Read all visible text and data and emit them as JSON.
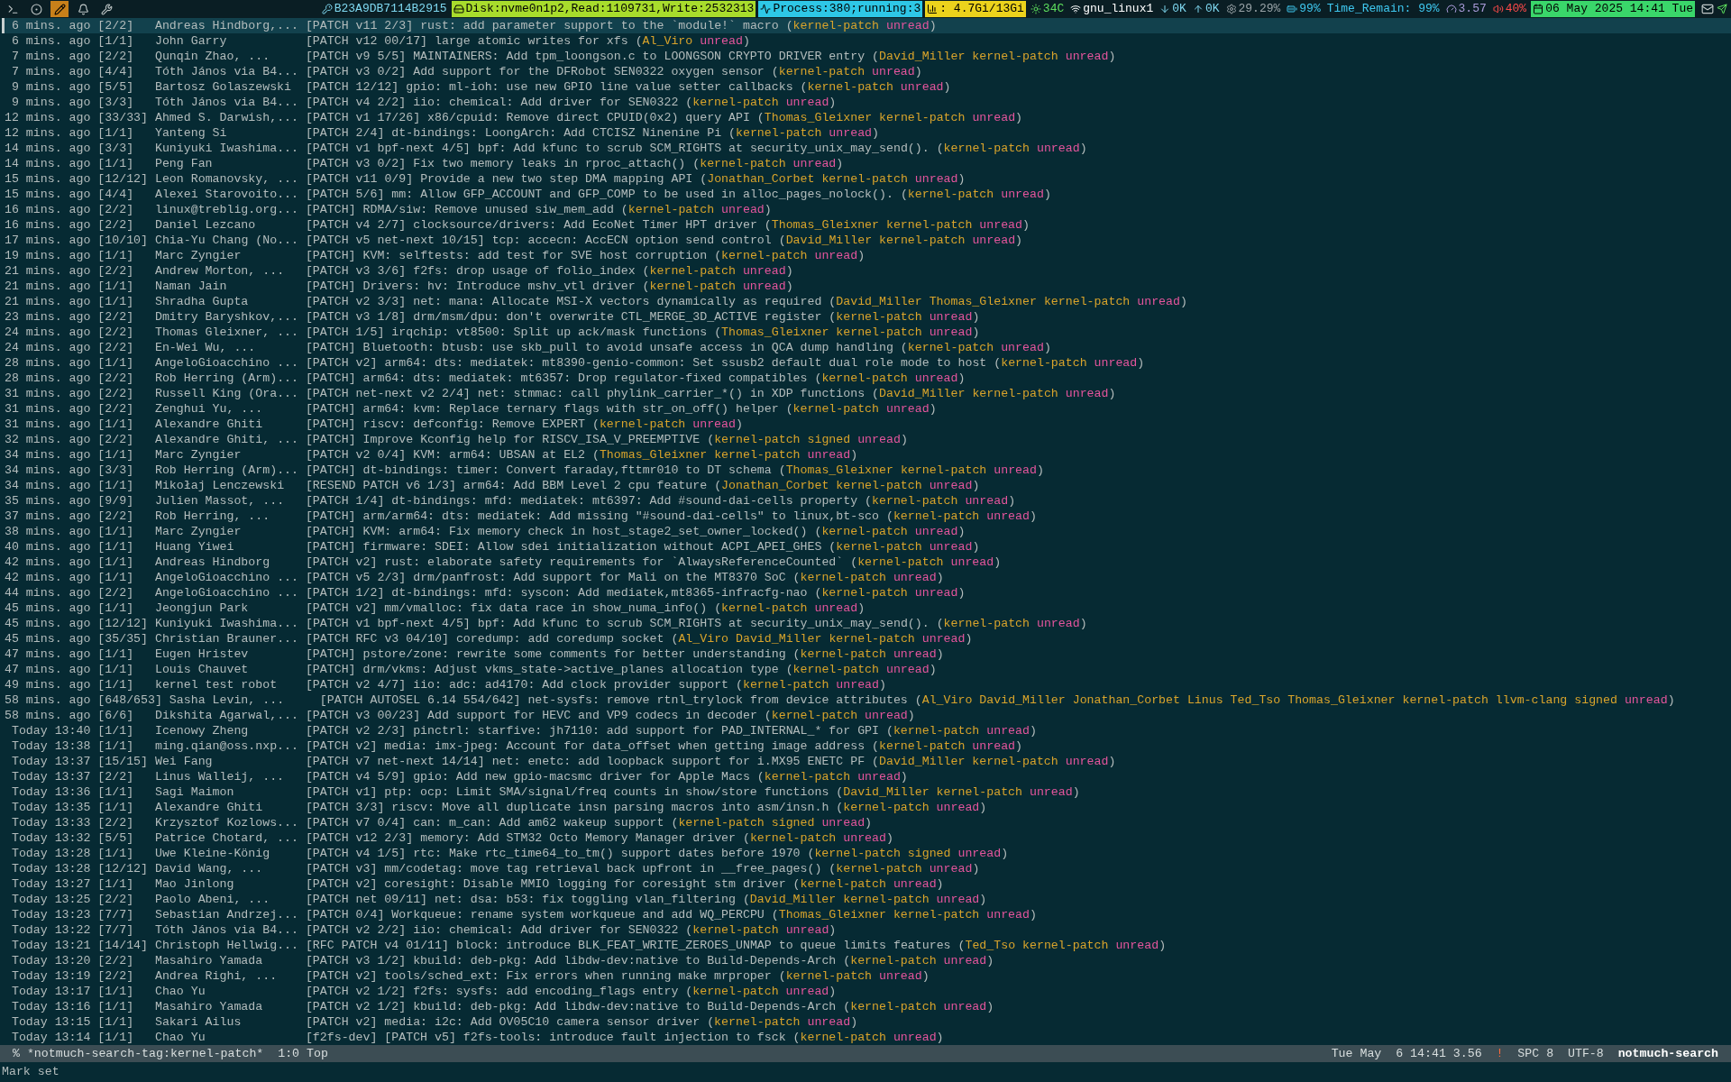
{
  "launcher": [
    {
      "selected": false
    },
    {
      "selected": false
    },
    {
      "selected": true
    },
    {
      "selected": false
    },
    {
      "selected": false
    }
  ],
  "status_items": [
    {
      "kind": "key",
      "text": "B23A9DB7114B2915"
    },
    {
      "kind": "disk",
      "text": "Disk:nvme0n1p2,Read:1109731,Write:2532313"
    },
    {
      "kind": "process",
      "text": "Process:380;running:3"
    },
    {
      "kind": "memory",
      "text": ": 4.7Gi/13Gi"
    },
    {
      "kind": "temp",
      "text": "34C"
    },
    {
      "kind": "wifi",
      "text": "gnu_linux1"
    },
    {
      "kind": "down",
      "text": "0K"
    },
    {
      "kind": "up",
      "text": "0K"
    },
    {
      "kind": "cpu",
      "text": "29.29%"
    },
    {
      "kind": "battery",
      "text": "99%"
    },
    {
      "kind": "plain",
      "text": "Time_Remain: 99%"
    },
    {
      "kind": "load",
      "text": "3.57"
    },
    {
      "kind": "volume",
      "text": "40%"
    },
    {
      "kind": "clock",
      "text": "06 May 2025 14:41 Tue"
    }
  ],
  "tag_brackets": [
    "(",
    ")"
  ],
  "rows": [
    {
      "date": "6 mins. ago",
      "count": "[2/2]",
      "authors": "Andreas Hindborg,...",
      "subject": "[PATCH v11 2/3] rust: add parameter support to the `module!` macro",
      "selected": true,
      "tags": [
        {
          "name": "kernel-patch",
          "color": "#d9a42b"
        },
        {
          "name": "unread",
          "color": "#e5559d"
        }
      ]
    },
    {
      "date": "6 mins. ago",
      "count": "[1/1]",
      "authors": "John Garry",
      "subject": "[PATCH v12 00/17] large atomic writes for xfs",
      "selected": false,
      "tags": [
        {
          "name": "Al_Viro",
          "color": "#d9a42b"
        },
        {
          "name": "unread",
          "color": "#e5559d"
        }
      ]
    },
    {
      "date": "7 mins. ago",
      "count": "[2/2]",
      "authors": "Qunqin Zhao, ...",
      "subject": "[PATCH v9 5/5] MAINTAINERS: Add tpm_loongson.c to LOONGSON CRYPTO DRIVER entry",
      "selected": false,
      "tags": [
        {
          "name": "David_Miller",
          "color": "#d9a42b"
        },
        {
          "name": "kernel-patch",
          "color": "#d9a42b"
        },
        {
          "name": "unread",
          "color": "#e5559d"
        }
      ]
    },
    {
      "date": "7 mins. ago",
      "count": "[4/4]",
      "authors": "Tóth János via B4...",
      "subject": "[PATCH v3 0/2] Add support for the DFRobot SEN0322 oxygen sensor",
      "selected": false,
      "tags": [
        {
          "name": "kernel-patch",
          "color": "#d9a42b"
        },
        {
          "name": "unread",
          "color": "#e5559d"
        }
      ]
    },
    {
      "date": "9 mins. ago",
      "count": "[5/5]",
      "authors": "Bartosz Golaszewski",
      "subject": "[PATCH 12/12] gpio: ml-ioh: use new GPIO line value setter callbacks",
      "selected": false,
      "tags": [
        {
          "name": "kernel-patch",
          "color": "#d9a42b"
        },
        {
          "name": "unread",
          "color": "#e5559d"
        }
      ]
    },
    {
      "date": "9 mins. ago",
      "count": "[3/3]",
      "authors": "Tóth János via B4...",
      "subject": "[PATCH v4 2/2] iio: chemical: Add driver for SEN0322",
      "selected": false,
      "tags": [
        {
          "name": "kernel-patch",
          "color": "#d9a42b"
        },
        {
          "name": "unread",
          "color": "#e5559d"
        }
      ]
    },
    {
      "date": "12 mins. ago",
      "count": "[33/33]",
      "authors": "Ahmed S. Darwish,...",
      "subject": "[PATCH v1 17/26] x86/cpuid: Remove direct CPUID(0x2) query API",
      "selected": false,
      "tags": [
        {
          "name": "Thomas_Gleixner",
          "color": "#d9a42b"
        },
        {
          "name": "kernel-patch",
          "color": "#d9a42b"
        },
        {
          "name": "unread",
          "color": "#e5559d"
        }
      ]
    },
    {
      "date": "12 mins. ago",
      "count": "[1/1]",
      "authors": "Yanteng Si",
      "subject": "[PATCH 2/4] dt-bindings: LoongArch: Add CTCISZ Ninenine Pi",
      "selected": false,
      "tags": [
        {
          "name": "kernel-patch",
          "color": "#d9a42b"
        },
        {
          "name": "unread",
          "color": "#e5559d"
        }
      ]
    },
    {
      "date": "14 mins. ago",
      "count": "[3/3]",
      "authors": "Kuniyuki Iwashima...",
      "subject": "[PATCH v1 bpf-next 4/5] bpf: Add kfunc to scrub SCM_RIGHTS at security_unix_may_send().",
      "selected": false,
      "tags": [
        {
          "name": "kernel-patch",
          "color": "#d9a42b"
        },
        {
          "name": "unread",
          "color": "#e5559d"
        }
      ]
    },
    {
      "date": "14 mins. ago",
      "count": "[1/1]",
      "authors": "Peng Fan",
      "subject": "[PATCH v3 0/2] Fix two memory leaks in rproc_attach()",
      "selected": false,
      "tags": [
        {
          "name": "kernel-patch",
          "color": "#d9a42b"
        },
        {
          "name": "unread",
          "color": "#e5559d"
        }
      ]
    },
    {
      "date": "15 mins. ago",
      "count": "[12/12]",
      "authors": "Leon Romanovsky, ...",
      "subject": "[PATCH v11 0/9] Provide a new two step DMA mapping API",
      "selected": false,
      "tags": [
        {
          "name": "Jonathan_Corbet",
          "color": "#d9a42b"
        },
        {
          "name": "kernel-patch",
          "color": "#d9a42b"
        },
        {
          "name": "unread",
          "color": "#e5559d"
        }
      ]
    },
    {
      "date": "15 mins. ago",
      "count": "[4/4]",
      "authors": "Alexei Starovoito...",
      "subject": "[PATCH 5/6] mm: Allow GFP_ACCOUNT and GFP_COMP to be used in alloc_pages_nolock().",
      "selected": false,
      "tags": [
        {
          "name": "kernel-patch",
          "color": "#d9a42b"
        },
        {
          "name": "unread",
          "color": "#e5559d"
        }
      ]
    },
    {
      "date": "16 mins. ago",
      "count": "[2/2]",
      "authors": "linux@treblig.org...",
      "subject": "[PATCH] RDMA/siw: Remove unused siw_mem_add",
      "selected": false,
      "tags": [
        {
          "name": "kernel-patch",
          "color": "#d9a42b"
        },
        {
          "name": "unread",
          "color": "#e5559d"
        }
      ]
    },
    {
      "date": "16 mins. ago",
      "count": "[2/2]",
      "authors": "Daniel Lezcano",
      "subject": "[PATCH v4 2/7] clocksource/drivers: Add EcoNet Timer HPT driver",
      "selected": false,
      "tags": [
        {
          "name": "Thomas_Gleixner",
          "color": "#d9a42b"
        },
        {
          "name": "kernel-patch",
          "color": "#d9a42b"
        },
        {
          "name": "unread",
          "color": "#e5559d"
        }
      ]
    },
    {
      "date": "17 mins. ago",
      "count": "[10/10]",
      "authors": "Chia-Yu Chang (No...",
      "subject": "[PATCH v5 net-next 10/15] tcp: accecn: AccECN option send control",
      "selected": false,
      "tags": [
        {
          "name": "David_Miller",
          "color": "#d9a42b"
        },
        {
          "name": "kernel-patch",
          "color": "#d9a42b"
        },
        {
          "name": "unread",
          "color": "#e5559d"
        }
      ]
    },
    {
      "date": "19 mins. ago",
      "count": "[1/1]",
      "authors": "Marc Zyngier",
      "subject": "[PATCH] KVM: selftests: add test for SVE host corruption",
      "selected": false,
      "tags": [
        {
          "name": "kernel-patch",
          "color": "#d9a42b"
        },
        {
          "name": "unread",
          "color": "#e5559d"
        }
      ]
    },
    {
      "date": "21 mins. ago",
      "count": "[2/2]",
      "authors": "Andrew Morton, ...",
      "subject": "[PATCH v3 3/6] f2fs: drop usage of folio_index",
      "selected": false,
      "tags": [
        {
          "name": "kernel-patch",
          "color": "#d9a42b"
        },
        {
          "name": "unread",
          "color": "#e5559d"
        }
      ]
    },
    {
      "date": "21 mins. ago",
      "count": "[1/1]",
      "authors": "Naman Jain",
      "subject": "[PATCH] Drivers: hv: Introduce mshv_vtl driver",
      "selected": false,
      "tags": [
        {
          "name": "kernel-patch",
          "color": "#d9a42b"
        },
        {
          "name": "unread",
          "color": "#e5559d"
        }
      ]
    },
    {
      "date": "21 mins. ago",
      "count": "[1/1]",
      "authors": "Shradha Gupta",
      "subject": "[PATCH v2 3/3] net: mana: Allocate MSI-X vectors dynamically as required",
      "selected": false,
      "tags": [
        {
          "name": "David_Miller",
          "color": "#d9a42b"
        },
        {
          "name": "Thomas_Gleixner",
          "color": "#d9a42b"
        },
        {
          "name": "kernel-patch",
          "color": "#d9a42b"
        },
        {
          "name": "unread",
          "color": "#e5559d"
        }
      ]
    },
    {
      "date": "23 mins. ago",
      "count": "[2/2]",
      "authors": "Dmitry Baryshkov,...",
      "subject": "[PATCH v3 1/8] drm/msm/dpu: don't overwrite CTL_MERGE_3D_ACTIVE register",
      "selected": false,
      "tags": [
        {
          "name": "kernel-patch",
          "color": "#d9a42b"
        },
        {
          "name": "unread",
          "color": "#e5559d"
        }
      ]
    },
    {
      "date": "24 mins. ago",
      "count": "[2/2]",
      "authors": "Thomas Gleixner, ...",
      "subject": "[PATCH 1/5] irqchip: vt8500: Split up ack/mask functions",
      "selected": false,
      "tags": [
        {
          "name": "Thomas_Gleixner",
          "color": "#d9a42b"
        },
        {
          "name": "kernel-patch",
          "color": "#d9a42b"
        },
        {
          "name": "unread",
          "color": "#e5559d"
        }
      ]
    },
    {
      "date": "24 mins. ago",
      "count": "[2/2]",
      "authors": "En-Wei Wu, ...",
      "subject": "[PATCH] Bluetooth: btusb: use skb_pull to avoid unsafe access in QCA dump handling",
      "selected": false,
      "tags": [
        {
          "name": "kernel-patch",
          "color": "#d9a42b"
        },
        {
          "name": "unread",
          "color": "#e5559d"
        }
      ]
    },
    {
      "date": "28 mins. ago",
      "count": "[1/1]",
      "authors": "AngeloGioacchino ...",
      "subject": "[PATCH v2] arm64: dts: mediatek: mt8390-genio-common: Set ssusb2 default dual role mode to host",
      "selected": false,
      "tags": [
        {
          "name": "kernel-patch",
          "color": "#d9a42b"
        },
        {
          "name": "unread",
          "color": "#e5559d"
        }
      ]
    },
    {
      "date": "28 mins. ago",
      "count": "[2/2]",
      "authors": "Rob Herring (Arm)...",
      "subject": "[PATCH] arm64: dts: mediatek: mt6357: Drop regulator-fixed compatibles",
      "selected": false,
      "tags": [
        {
          "name": "kernel-patch",
          "color": "#d9a42b"
        },
        {
          "name": "unread",
          "color": "#e5559d"
        }
      ]
    },
    {
      "date": "31 mins. ago",
      "count": "[2/2]",
      "authors": "Russell King (Ora...",
      "subject": "[PATCH net-next v2 2/4] net: stmmac: call phylink_carrier_*() in XDP functions",
      "selected": false,
      "tags": [
        {
          "name": "David_Miller",
          "color": "#d9a42b"
        },
        {
          "name": "kernel-patch",
          "color": "#d9a42b"
        },
        {
          "name": "unread",
          "color": "#e5559d"
        }
      ]
    },
    {
      "date": "31 mins. ago",
      "count": "[2/2]",
      "authors": "Zenghui Yu, ...",
      "subject": "[PATCH] arm64: kvm: Replace ternary flags with str_on_off() helper",
      "selected": false,
      "tags": [
        {
          "name": "kernel-patch",
          "color": "#d9a42b"
        },
        {
          "name": "unread",
          "color": "#e5559d"
        }
      ]
    },
    {
      "date": "31 mins. ago",
      "count": "[1/1]",
      "authors": "Alexandre Ghiti",
      "subject": "[PATCH] riscv: defconfig: Remove EXPERT",
      "selected": false,
      "tags": [
        {
          "name": "kernel-patch",
          "color": "#d9a42b"
        },
        {
          "name": "unread",
          "color": "#e5559d"
        }
      ]
    },
    {
      "date": "32 mins. ago",
      "count": "[2/2]",
      "authors": "Alexandre Ghiti, ...",
      "subject": "[PATCH] Improve Kconfig help for RISCV_ISA_V_PREEMPTIVE",
      "selected": false,
      "tags": [
        {
          "name": "kernel-patch",
          "color": "#d9a42b"
        },
        {
          "name": "signed",
          "color": "#d9a42b"
        },
        {
          "name": "unread",
          "color": "#e5559d"
        }
      ]
    },
    {
      "date": "34 mins. ago",
      "count": "[1/1]",
      "authors": "Marc Zyngier",
      "subject": "[PATCH v2 0/4] KVM: arm64: UBSAN at EL2",
      "selected": false,
      "tags": [
        {
          "name": "Thomas_Gleixner",
          "color": "#d9a42b"
        },
        {
          "name": "kernel-patch",
          "color": "#d9a42b"
        },
        {
          "name": "unread",
          "color": "#e5559d"
        }
      ]
    },
    {
      "date": "34 mins. ago",
      "count": "[3/3]",
      "authors": "Rob Herring (Arm)...",
      "subject": "[PATCH] dt-bindings: timer: Convert faraday,fttmr010 to DT schema",
      "selected": false,
      "tags": [
        {
          "name": "Thomas_Gleixner",
          "color": "#d9a42b"
        },
        {
          "name": "kernel-patch",
          "color": "#d9a42b"
        },
        {
          "name": "unread",
          "color": "#e5559d"
        }
      ]
    },
    {
      "date": "34 mins. ago",
      "count": "[1/1]",
      "authors": "Mikołaj Lenczewski",
      "subject": "[RESEND PATCH v6 1/3] arm64: Add BBM Level 2 cpu feature",
      "selected": false,
      "tags": [
        {
          "name": "Jonathan_Corbet",
          "color": "#d9a42b"
        },
        {
          "name": "kernel-patch",
          "color": "#d9a42b"
        },
        {
          "name": "unread",
          "color": "#e5559d"
        }
      ]
    },
    {
      "date": "35 mins. ago",
      "count": "[9/9]",
      "authors": "Julien Massot, ...",
      "subject": "[PATCH 1/4] dt-bindings: mfd: mediatek: mt6397: Add #sound-dai-cells property",
      "selected": false,
      "tags": [
        {
          "name": "kernel-patch",
          "color": "#d9a42b"
        },
        {
          "name": "unread",
          "color": "#e5559d"
        }
      ]
    },
    {
      "date": "37 mins. ago",
      "count": "[2/2]",
      "authors": "Rob Herring, ...",
      "subject": "[PATCH] arm/arm64: dts: mediatek: Add missing \"#sound-dai-cells\" to linux,bt-sco",
      "selected": false,
      "tags": [
        {
          "name": "kernel-patch",
          "color": "#d9a42b"
        },
        {
          "name": "unread",
          "color": "#e5559d"
        }
      ]
    },
    {
      "date": "38 mins. ago",
      "count": "[1/1]",
      "authors": "Marc Zyngier",
      "subject": "[PATCH] KVM: arm64: Fix memory check in host_stage2_set_owner_locked()",
      "selected": false,
      "tags": [
        {
          "name": "kernel-patch",
          "color": "#d9a42b"
        },
        {
          "name": "unread",
          "color": "#e5559d"
        }
      ]
    },
    {
      "date": "40 mins. ago",
      "count": "[1/1]",
      "authors": "Huang Yiwei",
      "subject": "[PATCH] firmware: SDEI: Allow sdei initialization without ACPI_APEI_GHES",
      "selected": false,
      "tags": [
        {
          "name": "kernel-patch",
          "color": "#d9a42b"
        },
        {
          "name": "unread",
          "color": "#e5559d"
        }
      ]
    },
    {
      "date": "42 mins. ago",
      "count": "[1/1]",
      "authors": "Andreas Hindborg",
      "subject": "[PATCH v2] rust: elaborate safety requirements for `AlwaysReferenceCounted`",
      "selected": false,
      "tags": [
        {
          "name": "kernel-patch",
          "color": "#d9a42b"
        },
        {
          "name": "unread",
          "color": "#e5559d"
        }
      ]
    },
    {
      "date": "42 mins. ago",
      "count": "[1/1]",
      "authors": "AngeloGioacchino ...",
      "subject": "[PATCH v5 2/3] drm/panfrost: Add support for Mali on the MT8370 SoC",
      "selected": false,
      "tags": [
        {
          "name": "kernel-patch",
          "color": "#d9a42b"
        },
        {
          "name": "unread",
          "color": "#e5559d"
        }
      ]
    },
    {
      "date": "44 mins. ago",
      "count": "[2/2]",
      "authors": "AngeloGioacchino ...",
      "subject": "[PATCH 1/2] dt-bindings: mfd: syscon: Add mediatek,mt8365-infracfg-nao",
      "selected": false,
      "tags": [
        {
          "name": "kernel-patch",
          "color": "#d9a42b"
        },
        {
          "name": "unread",
          "color": "#e5559d"
        }
      ]
    },
    {
      "date": "45 mins. ago",
      "count": "[1/1]",
      "authors": "Jeongjun Park",
      "subject": "[PATCH v2] mm/vmalloc: fix data race in show_numa_info()",
      "selected": false,
      "tags": [
        {
          "name": "kernel-patch",
          "color": "#d9a42b"
        },
        {
          "name": "unread",
          "color": "#e5559d"
        }
      ]
    },
    {
      "date": "45 mins. ago",
      "count": "[12/12]",
      "authors": "Kuniyuki Iwashima...",
      "subject": "[PATCH v1 bpf-next 4/5] bpf: Add kfunc to scrub SCM_RIGHTS at security_unix_may_send().",
      "selected": false,
      "tags": [
        {
          "name": "kernel-patch",
          "color": "#d9a42b"
        },
        {
          "name": "unread",
          "color": "#e5559d"
        }
      ]
    },
    {
      "date": "45 mins. ago",
      "count": "[35/35]",
      "authors": "Christian Brauner...",
      "subject": "[PATCH RFC v3 04/10] coredump: add coredump socket",
      "selected": false,
      "tags": [
        {
          "name": "Al_Viro",
          "color": "#d9a42b"
        },
        {
          "name": "David_Miller",
          "color": "#d9a42b"
        },
        {
          "name": "kernel-patch",
          "color": "#d9a42b"
        },
        {
          "name": "unread",
          "color": "#e5559d"
        }
      ]
    },
    {
      "date": "47 mins. ago",
      "count": "[1/1]",
      "authors": "Eugen Hristev",
      "subject": "[PATCH] pstore/zone: rewrite some comments for better understanding",
      "selected": false,
      "tags": [
        {
          "name": "kernel-patch",
          "color": "#d9a42b"
        },
        {
          "name": "unread",
          "color": "#e5559d"
        }
      ]
    },
    {
      "date": "47 mins. ago",
      "count": "[1/1]",
      "authors": "Louis Chauvet",
      "subject": "[PATCH] drm/vkms: Adjust vkms_state->active_planes allocation type",
      "selected": false,
      "tags": [
        {
          "name": "kernel-patch",
          "color": "#d9a42b"
        },
        {
          "name": "unread",
          "color": "#e5559d"
        }
      ]
    },
    {
      "date": "49 mins. ago",
      "count": "[1/1]",
      "authors": "kernel test robot",
      "subject": "[PATCH v2 4/7] iio: adc: ad4170: Add clock provider support",
      "selected": false,
      "tags": [
        {
          "name": "kernel-patch",
          "color": "#d9a42b"
        },
        {
          "name": "unread",
          "color": "#e5559d"
        }
      ]
    },
    {
      "date": "58 mins. ago",
      "count": "[648/653]",
      "authors": "Sasha Levin, ...",
      "subject": "[PATCH AUTOSEL 6.14 554/642] net-sysfs: remove rtnl_trylock from device attributes",
      "selected": false,
      "tags": [
        {
          "name": "Al_Viro",
          "color": "#d9a42b"
        },
        {
          "name": "David_Miller",
          "color": "#d9a42b"
        },
        {
          "name": "Jonathan_Corbet",
          "color": "#d9a42b"
        },
        {
          "name": "Linus",
          "color": "#d9a42b"
        },
        {
          "name": "Ted_Tso",
          "color": "#d9a42b"
        },
        {
          "name": "Thomas_Gleixner",
          "color": "#d9a42b"
        },
        {
          "name": "kernel-patch",
          "color": "#d9a42b"
        },
        {
          "name": "llvm-clang",
          "color": "#d9a42b"
        },
        {
          "name": "signed",
          "color": "#d9a42b"
        },
        {
          "name": "unread",
          "color": "#e5559d"
        }
      ]
    },
    {
      "date": "58 mins. ago",
      "count": "[6/6]",
      "authors": "Dikshita Agarwal,...",
      "subject": "[PATCH v3 00/23] Add support for HEVC and VP9 codecs in decoder",
      "selected": false,
      "tags": [
        {
          "name": "kernel-patch",
          "color": "#d9a42b"
        },
        {
          "name": "unread",
          "color": "#e5559d"
        }
      ]
    },
    {
      "date": "Today 13:40",
      "count": "[1/1]",
      "authors": "Icenowy Zheng",
      "subject": "[PATCH v2 2/3] pinctrl: starfive: jh7110: add support for PAD_INTERNAL_* for GPI",
      "selected": false,
      "tags": [
        {
          "name": "kernel-patch",
          "color": "#d9a42b"
        },
        {
          "name": "unread",
          "color": "#e5559d"
        }
      ]
    },
    {
      "date": "Today 13:38",
      "count": "[1/1]",
      "authors": "ming.qian@oss.nxp...",
      "subject": "[PATCH v2] media: imx-jpeg: Account for data_offset when getting image address",
      "selected": false,
      "tags": [
        {
          "name": "kernel-patch",
          "color": "#d9a42b"
        },
        {
          "name": "unread",
          "color": "#e5559d"
        }
      ]
    },
    {
      "date": "Today 13:37",
      "count": "[15/15]",
      "authors": "Wei Fang",
      "subject": "[PATCH v7 net-next 14/14] net: enetc: add loopback support for i.MX95 ENETC PF",
      "selected": false,
      "tags": [
        {
          "name": "David_Miller",
          "color": "#d9a42b"
        },
        {
          "name": "kernel-patch",
          "color": "#d9a42b"
        },
        {
          "name": "unread",
          "color": "#e5559d"
        }
      ]
    },
    {
      "date": "Today 13:37",
      "count": "[2/2]",
      "authors": "Linus Walleij, ...",
      "subject": "[PATCH v4 5/9] gpio: Add new gpio-macsmc driver for Apple Macs",
      "selected": false,
      "tags": [
        {
          "name": "kernel-patch",
          "color": "#d9a42b"
        },
        {
          "name": "unread",
          "color": "#e5559d"
        }
      ]
    },
    {
      "date": "Today 13:36",
      "count": "[1/1]",
      "authors": "Sagi Maimon",
      "subject": "[PATCH v1] ptp: ocp: Limit SMA/signal/freq counts in show/store functions",
      "selected": false,
      "tags": [
        {
          "name": "David_Miller",
          "color": "#d9a42b"
        },
        {
          "name": "kernel-patch",
          "color": "#d9a42b"
        },
        {
          "name": "unread",
          "color": "#e5559d"
        }
      ]
    },
    {
      "date": "Today 13:35",
      "count": "[1/1]",
      "authors": "Alexandre Ghiti",
      "subject": "[PATCH 3/3] riscv: Move all duplicate insn parsing macros into asm/insn.h",
      "selected": false,
      "tags": [
        {
          "name": "kernel-patch",
          "color": "#d9a42b"
        },
        {
          "name": "unread",
          "color": "#e5559d"
        }
      ]
    },
    {
      "date": "Today 13:33",
      "count": "[2/2]",
      "authors": "Krzysztof Kozlows...",
      "subject": "[PATCH v7 0/4] can: m_can: Add am62 wakeup support",
      "selected": false,
      "tags": [
        {
          "name": "kernel-patch",
          "color": "#d9a42b"
        },
        {
          "name": "signed",
          "color": "#d9a42b"
        },
        {
          "name": "unread",
          "color": "#e5559d"
        }
      ]
    },
    {
      "date": "Today 13:32",
      "count": "[5/5]",
      "authors": "Patrice Chotard, ...",
      "subject": "[PATCH v12 2/3] memory: Add STM32 Octo Memory Manager driver",
      "selected": false,
      "tags": [
        {
          "name": "kernel-patch",
          "color": "#d9a42b"
        },
        {
          "name": "unread",
          "color": "#e5559d"
        }
      ]
    },
    {
      "date": "Today 13:28",
      "count": "[1/1]",
      "authors": "Uwe Kleine-König",
      "subject": "[PATCH v4 1/5] rtc: Make rtc_time64_to_tm() support dates before 1970",
      "selected": false,
      "tags": [
        {
          "name": "kernel-patch",
          "color": "#d9a42b"
        },
        {
          "name": "signed",
          "color": "#d9a42b"
        },
        {
          "name": "unread",
          "color": "#e5559d"
        }
      ]
    },
    {
      "date": "Today 13:28",
      "count": "[12/12]",
      "authors": "David Wang, ...",
      "subject": "[PATCH v3] mm/codetag: move tag retrieval back upfront in __free_pages()",
      "selected": false,
      "tags": [
        {
          "name": "kernel-patch",
          "color": "#d9a42b"
        },
        {
          "name": "unread",
          "color": "#e5559d"
        }
      ]
    },
    {
      "date": "Today 13:27",
      "count": "[1/1]",
      "authors": "Mao Jinlong",
      "subject": "[PATCH v2] coresight: Disable MMIO logging for coresight stm driver",
      "selected": false,
      "tags": [
        {
          "name": "kernel-patch",
          "color": "#d9a42b"
        },
        {
          "name": "unread",
          "color": "#e5559d"
        }
      ]
    },
    {
      "date": "Today 13:25",
      "count": "[2/2]",
      "authors": "Paolo Abeni, ...",
      "subject": "[PATCH net 09/11] net: dsa: b53: fix toggling vlan_filtering",
      "selected": false,
      "tags": [
        {
          "name": "David_Miller",
          "color": "#d9a42b"
        },
        {
          "name": "kernel-patch",
          "color": "#d9a42b"
        },
        {
          "name": "unread",
          "color": "#e5559d"
        }
      ]
    },
    {
      "date": "Today 13:23",
      "count": "[7/7]",
      "authors": "Sebastian Andrzej...",
      "subject": "[PATCH 0/4] Workqueue: rename system workqueue and add WQ_PERCPU",
      "selected": false,
      "tags": [
        {
          "name": "Thomas_Gleixner",
          "color": "#d9a42b"
        },
        {
          "name": "kernel-patch",
          "color": "#d9a42b"
        },
        {
          "name": "unread",
          "color": "#e5559d"
        }
      ]
    },
    {
      "date": "Today 13:22",
      "count": "[7/7]",
      "authors": "Tóth János via B4...",
      "subject": "[PATCH v2 2/2] iio: chemical: Add driver for SEN0322",
      "selected": false,
      "tags": [
        {
          "name": "kernel-patch",
          "color": "#d9a42b"
        },
        {
          "name": "unread",
          "color": "#e5559d"
        }
      ]
    },
    {
      "date": "Today 13:21",
      "count": "[14/14]",
      "authors": "Christoph Hellwig...",
      "subject": "[RFC PATCH v4 01/11] block: introduce BLK_FEAT_WRITE_ZEROES_UNMAP to queue limits features",
      "selected": false,
      "tags": [
        {
          "name": "Ted_Tso",
          "color": "#d9a42b"
        },
        {
          "name": "kernel-patch",
          "color": "#d9a42b"
        },
        {
          "name": "unread",
          "color": "#e5559d"
        }
      ]
    },
    {
      "date": "Today 13:20",
      "count": "[2/2]",
      "authors": "Masahiro Yamada",
      "subject": "[PATCH v3 1/2] kbuild: deb-pkg: Add libdw-dev:native to Build-Depends-Arch",
      "selected": false,
      "tags": [
        {
          "name": "kernel-patch",
          "color": "#d9a42b"
        },
        {
          "name": "unread",
          "color": "#e5559d"
        }
      ]
    },
    {
      "date": "Today 13:19",
      "count": "[2/2]",
      "authors": "Andrea Righi, ...",
      "subject": "[PATCH v2] tools/sched_ext: Fix errors when running make mrproper",
      "selected": false,
      "tags": [
        {
          "name": "kernel-patch",
          "color": "#d9a42b"
        },
        {
          "name": "unread",
          "color": "#e5559d"
        }
      ]
    },
    {
      "date": "Today 13:17",
      "count": "[1/1]",
      "authors": "Chao Yu",
      "subject": "[PATCH v2 1/2] f2fs: sysfs: add encoding_flags entry",
      "selected": false,
      "tags": [
        {
          "name": "kernel-patch",
          "color": "#d9a42b"
        },
        {
          "name": "unread",
          "color": "#e5559d"
        }
      ]
    },
    {
      "date": "Today 13:16",
      "count": "[1/1]",
      "authors": "Masahiro Yamada",
      "subject": "[PATCH v2 1/2] kbuild: deb-pkg: Add libdw-dev:native to Build-Depends-Arch",
      "selected": false,
      "tags": [
        {
          "name": "kernel-patch",
          "color": "#d9a42b"
        },
        {
          "name": "unread",
          "color": "#e5559d"
        }
      ]
    },
    {
      "date": "Today 13:15",
      "count": "[1/1]",
      "authors": "Sakari Ailus",
      "subject": "[PATCH v2] media: i2c: Add OV05C10 camera sensor driver",
      "selected": false,
      "tags": [
        {
          "name": "kernel-patch",
          "color": "#d9a42b"
        },
        {
          "name": "unread",
          "color": "#e5559d"
        }
      ]
    },
    {
      "date": "Today 13:14",
      "count": "[1/1]",
      "authors": "Chao Yu",
      "subject": "[f2fs-dev] [PATCH v5] f2fs-tools: introduce fault injection to fsck",
      "selected": false,
      "tags": [
        {
          "name": "kernel-patch",
          "color": "#d9a42b"
        },
        {
          "name": "unread",
          "color": "#e5559d"
        }
      ]
    }
  ],
  "mode_line": {
    "buffer": "% *notmuch-search-tag:kernel-patch*",
    "position": "1:0 Top",
    "time": "Tue May  6 14:41 3.56",
    "warning": "!",
    "indent": "SPC 8",
    "encoding": "UTF-8",
    "mode": "notmuch-search"
  },
  "echo_area": "Mark set"
}
